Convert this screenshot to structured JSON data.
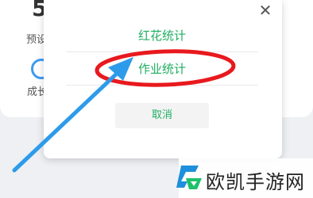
{
  "background": {
    "big_number": "5",
    "label_top": "预设",
    "label_bottom": "成长"
  },
  "dialog": {
    "options": [
      {
        "label": "红花统计"
      },
      {
        "label": "作业统计"
      }
    ],
    "cancel_label": "取消",
    "close_glyph": "✕"
  },
  "annotation": {
    "ellipse_color": "#e8191e",
    "arrow_color": "#2e9bea"
  },
  "watermark": {
    "text": "欧凯手游网",
    "logo_icon": "ok-logo-icon"
  },
  "colors": {
    "accent_green": "#1fae62",
    "accent_blue": "#3b9af2"
  }
}
